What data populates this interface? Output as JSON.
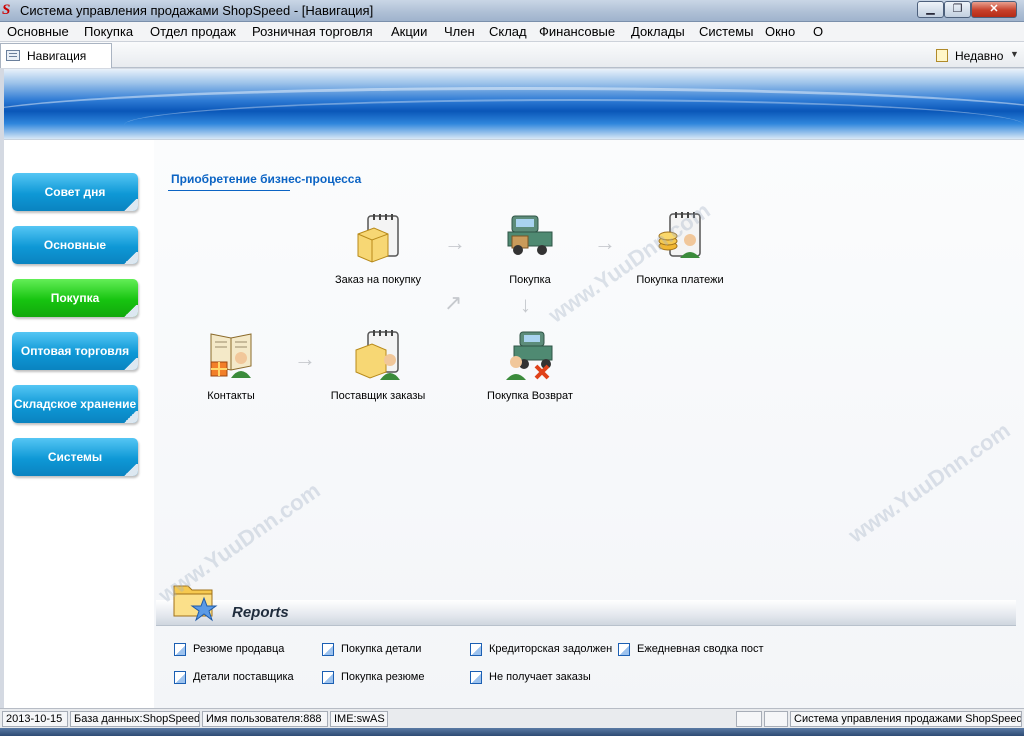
{
  "window": {
    "title": "Система управления продажами ShopSpeed - [Навигация]",
    "logo": "S",
    "min_glyph": "▁",
    "max_glyph": "❐",
    "close_glyph": "✕"
  },
  "menu": [
    "Основные",
    "Покупка",
    "Отдел продаж",
    "Розничная торговля",
    "Акции",
    "Член",
    "Склад",
    "Финансовые",
    "Доклады",
    "Системы",
    "Окно",
    "О"
  ],
  "tab": {
    "label": "Навигация"
  },
  "recent": {
    "label": "Недавно",
    "chevron": "▼"
  },
  "sidebar": {
    "items": [
      {
        "label": "Совет дня",
        "active": false
      },
      {
        "label": "Основные",
        "active": false
      },
      {
        "label": "Покупка",
        "active": true
      },
      {
        "label": "Оптовая торговля",
        "active": false
      },
      {
        "label": "Складское хранение",
        "active": false
      },
      {
        "label": "Системы",
        "active": false
      }
    ]
  },
  "process": {
    "title": "Приобретение бизнес-процесса",
    "nodes": {
      "purchase_order": {
        "label": "Заказ на покупку",
        "icon": "clipboard-box-icon"
      },
      "purchase": {
        "label": "Покупка",
        "icon": "truck-icon"
      },
      "purchase_payments": {
        "label": "Покупка платежи",
        "icon": "payments-icon"
      },
      "contacts": {
        "label": "Контакты",
        "icon": "contacts-book-icon"
      },
      "supplier_orders": {
        "label": "Поставщик заказы",
        "icon": "supplier-order-icon"
      },
      "purchase_return": {
        "label": "Покупка Возврат",
        "icon": "truck-return-icon"
      }
    },
    "arrow_right": "→",
    "arrow_down": "↓",
    "arrow_diag": "↗"
  },
  "reports": {
    "title": "Reports",
    "links": [
      [
        "Резюме продавца",
        "Покупка детали",
        "Кредиторская задолжен",
        "Ежедневная сводка пост"
      ],
      [
        "Детали поставщика",
        "Покупка резюме",
        "Не получает заказы"
      ]
    ]
  },
  "status": {
    "date": "2013-10-15",
    "database": "База данных:ShopSpeed",
    "user": "Имя пользователя:888",
    "ime": "IME:swAS",
    "app": "Система управления продажами ShopSpeed"
  },
  "watermark": "www.YuuDnn.com",
  "colors": {
    "accent": "#0b64c4",
    "sidebar_btn": "#0e98d6",
    "sidebar_active": "#17c410"
  }
}
